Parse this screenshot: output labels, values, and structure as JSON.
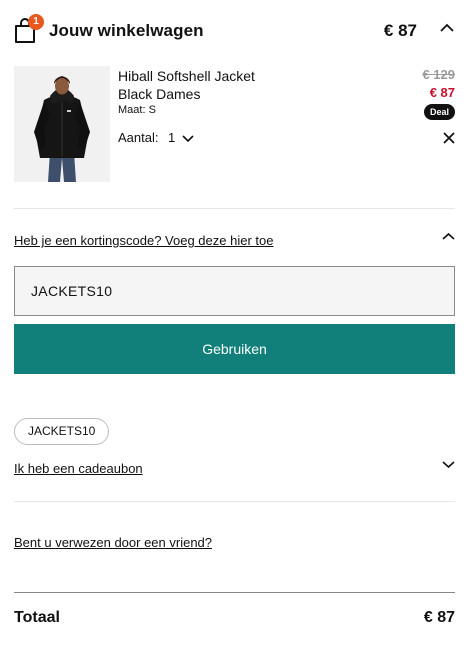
{
  "cart": {
    "title": "Jouw winkelwagen",
    "count_badge": "1",
    "total": "€ 87"
  },
  "product": {
    "name": "Hiball Softshell Jacket Black Dames",
    "size": "Maat: S",
    "old_price": "€ 129",
    "new_price": "€ 87",
    "deal_badge": "Deal",
    "qty_label": "Aantal:",
    "qty_value": "1",
    "image": "black-softshell-jacket-photo"
  },
  "discount": {
    "link_text": "Heb je een kortingscode? Voeg deze hier toe",
    "input_value": "JACKETS10",
    "apply_label": "Gebruiken",
    "applied_code": "JACKETS10"
  },
  "giftcard": {
    "link_text": "Ik heb een cadeaubon"
  },
  "referral": {
    "link_text": "Bent u verwezen door een vriend?"
  },
  "totals": {
    "label": "Totaal",
    "value": "€ 87"
  },
  "colors": {
    "accent": "#11807a",
    "sale": "#c8102e",
    "badge": "#e8591e"
  }
}
